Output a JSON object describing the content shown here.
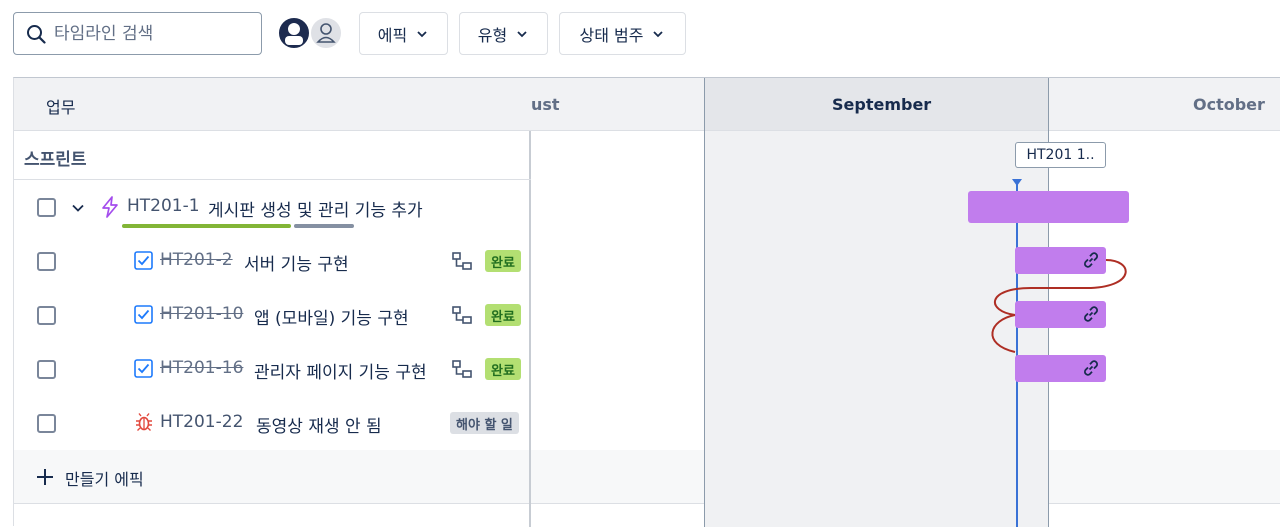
{
  "toolbar": {
    "search_placeholder": "타임라인 검색",
    "filters": [
      {
        "label": "에픽"
      },
      {
        "label": "유형"
      },
      {
        "label": "상태 범주"
      }
    ]
  },
  "table": {
    "work_header": "업무",
    "sprint_label": "스프린트",
    "months": [
      "ust",
      "September",
      "October"
    ],
    "sprint_marker": "HT201 1..",
    "epic": {
      "key": "HT201-1",
      "summary": "게시판 생성 및 관리 기능 추가",
      "progress": {
        "done": 0.73,
        "remaining": 0.27
      },
      "colors": {
        "done": "#82b536",
        "remaining": "#8590a2"
      }
    },
    "issues": [
      {
        "key": "HT201-2",
        "summary": "서버 기능 구현",
        "status": "완료",
        "done": true
      },
      {
        "key": "HT201-10",
        "summary": "앱 (모바일) 기능 구현",
        "status": "완료",
        "done": true
      },
      {
        "key": "HT201-16",
        "summary": "관리자 페이지 기능 구현",
        "status": "완료",
        "done": true
      },
      {
        "key": "HT201-22",
        "summary": "동영상 재생 안 됨",
        "status": "해야 할 일",
        "done": false
      }
    ],
    "create_epic": "만들기 에픽"
  },
  "colors": {
    "bar": "#c17ded",
    "today_line": "#3a72d6",
    "dependency": "#ae2e24",
    "epic_icon": "#a44ded",
    "bug_icon": "#e2483d",
    "task_icon": "#1d7afc"
  }
}
